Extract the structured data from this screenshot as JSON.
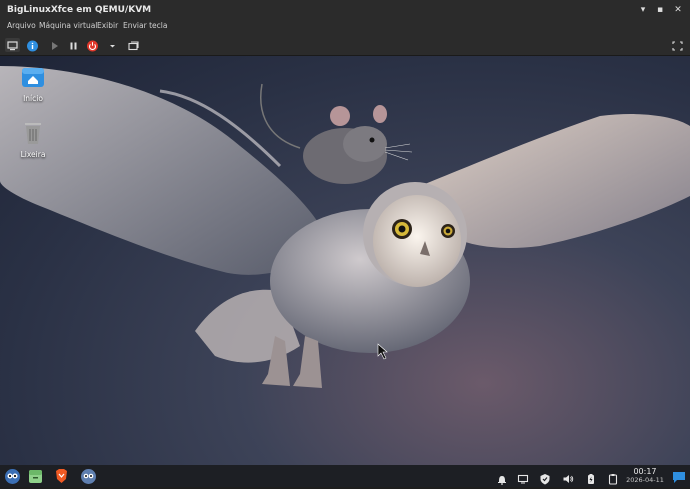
{
  "window": {
    "title": "BigLinuxXfce em QEMU/KVM"
  },
  "menu": [
    "Arquivo",
    "Máquina virtual",
    "Exibir",
    "Enviar tecla"
  ],
  "desktop": {
    "icons": [
      {
        "label": "Início"
      },
      {
        "label": "Lixeira"
      }
    ]
  },
  "clock": {
    "time": "00:17",
    "date": "2026-04-11"
  },
  "colors": {
    "accent_blue": "#2f8fe0",
    "power_red": "#e0382b",
    "taskbar": "#1d1f24"
  }
}
